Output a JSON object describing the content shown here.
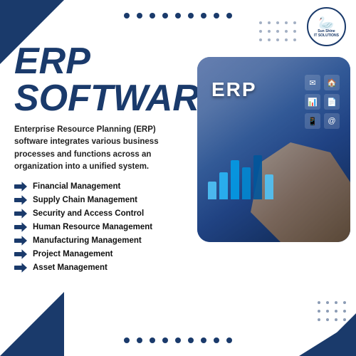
{
  "page": {
    "title": "ERP SOFTWARE",
    "title_line1": "ERP",
    "title_line2": "SOFTWARE"
  },
  "logo": {
    "name": "Sun Shine",
    "line1": "Sun Shine",
    "line2": "IT SOLUTIONS"
  },
  "description": "Enterprise Resource Planning (ERP) software integrates various business processes and functions across an organization into a unified system.",
  "features": [
    {
      "label": "Financial Management"
    },
    {
      "label": "Supply Chain Management"
    },
    {
      "label": "Security and Access Control"
    },
    {
      "label": "Human Resource Management"
    },
    {
      "label": "Manufacturing Management"
    },
    {
      "label": "Project Management"
    },
    {
      "label": "Asset Management"
    }
  ],
  "image_label": "ERP",
  "dots_top_count": 9,
  "dots_bottom_count": 9,
  "chart_bars": [
    {
      "height": 25,
      "color": "#4fc3f7"
    },
    {
      "height": 38,
      "color": "#29b6f6"
    },
    {
      "height": 55,
      "color": "#039be5"
    },
    {
      "height": 45,
      "color": "#0288d1"
    },
    {
      "height": 62,
      "color": "#01579b"
    },
    {
      "height": 35,
      "color": "#4fc3f7"
    }
  ],
  "colors": {
    "primary": "#1a3a6b",
    "accent": "#2a5298",
    "white": "#ffffff",
    "text": "#111111"
  }
}
